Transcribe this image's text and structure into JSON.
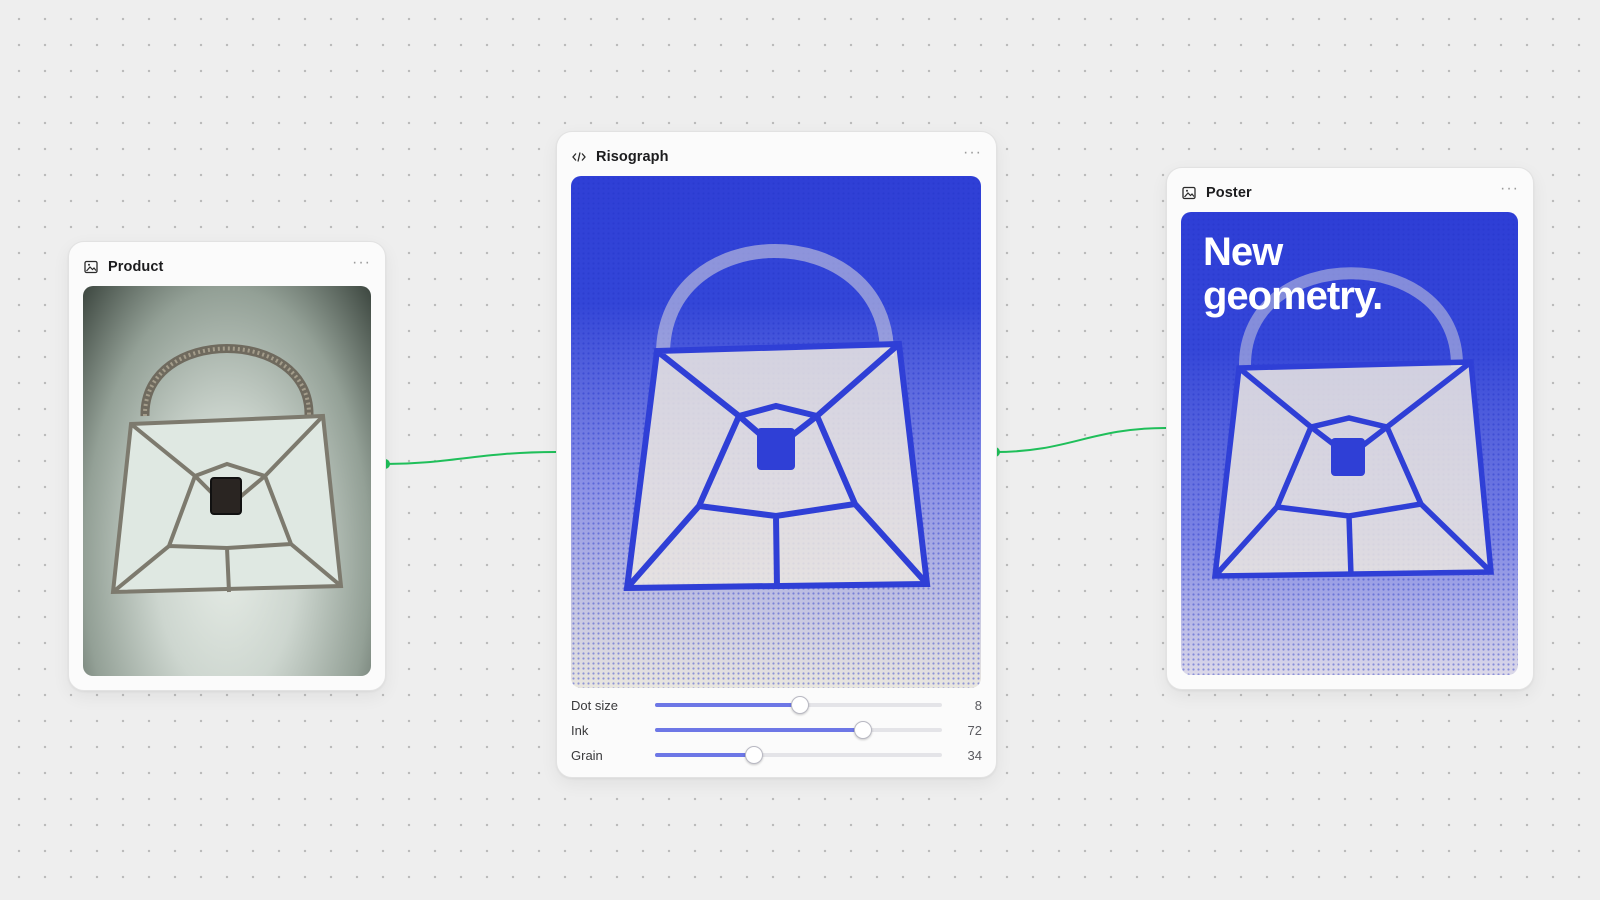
{
  "nodes": {
    "product": {
      "title": "Product",
      "icon": "image-icon"
    },
    "risograph": {
      "title": "Risograph",
      "icon": "code-icon"
    },
    "poster": {
      "title": "Poster",
      "icon": "image-icon"
    }
  },
  "more_label": "···",
  "sliders": [
    {
      "label": "Dot size",
      "value": "8",
      "fraction": 0.5
    },
    {
      "label": "Ink",
      "value": "72",
      "fraction": 0.72
    },
    {
      "label": "Grain",
      "value": "34",
      "fraction": 0.34
    }
  ],
  "poster": {
    "headline_line1": "New",
    "headline_line2": "geometry."
  },
  "colors": {
    "connector": "#1fbf5a",
    "riso_blue": "#2f3fd6",
    "slider_fill": "#6d77e6",
    "canvas": "#eeeeee"
  }
}
